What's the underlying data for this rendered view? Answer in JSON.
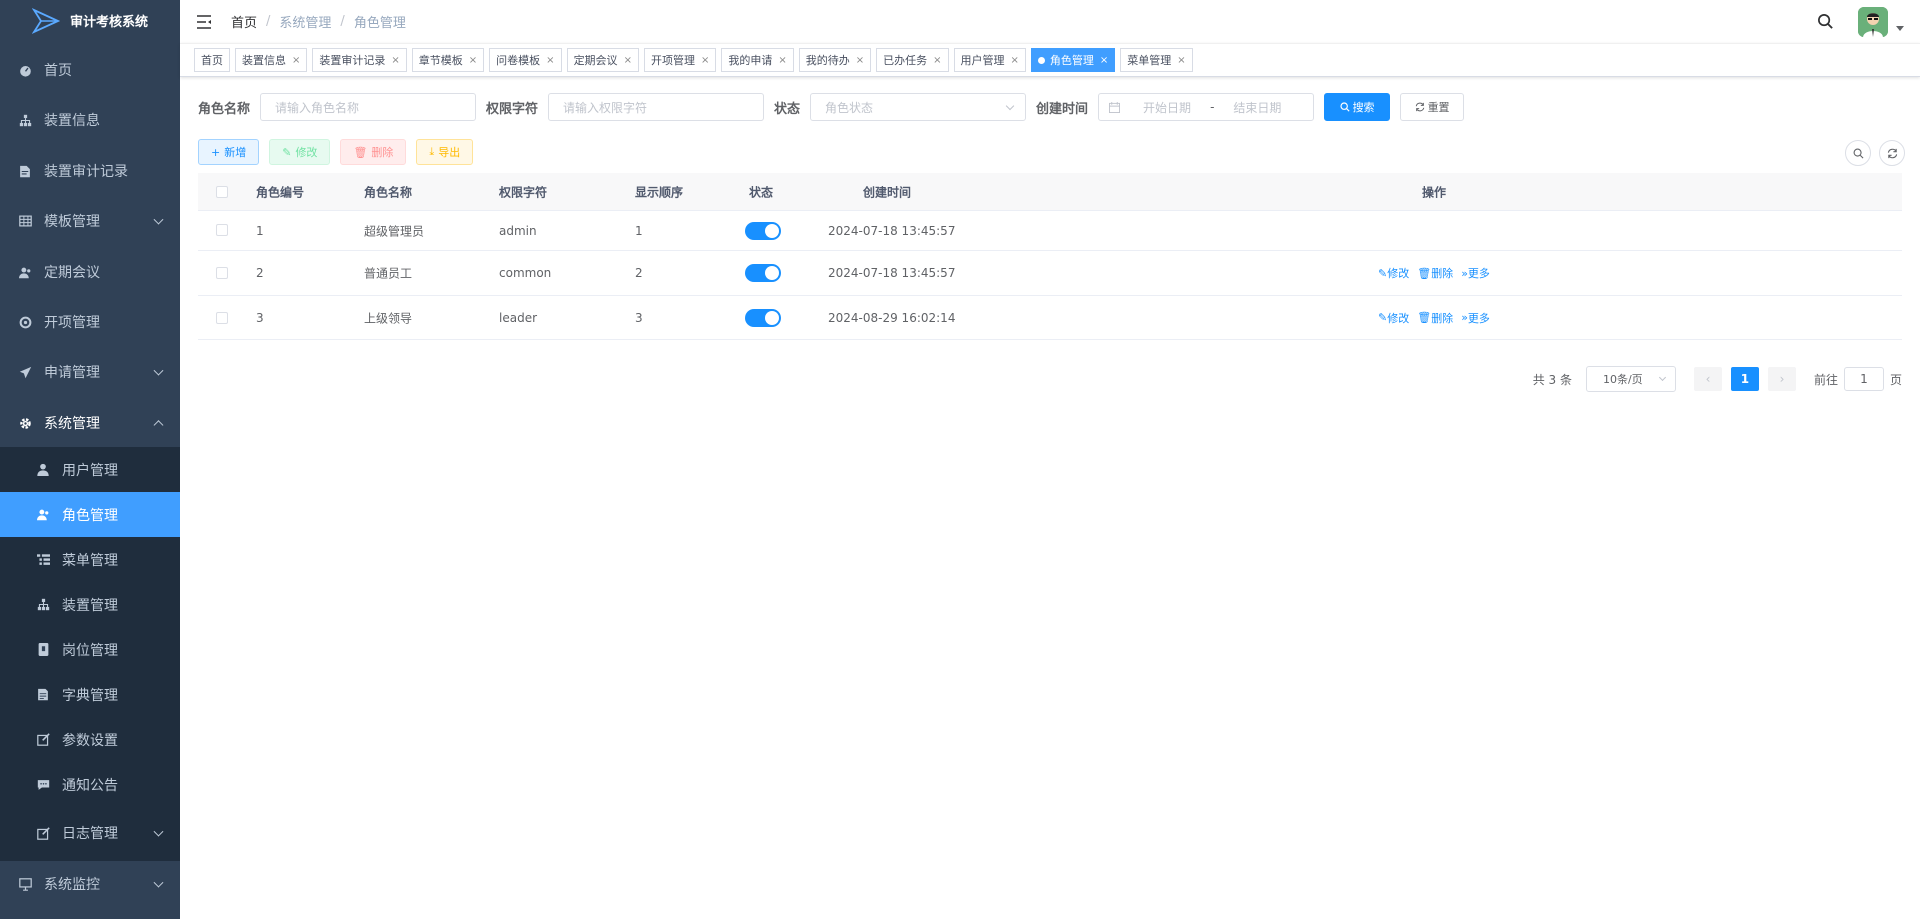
{
  "app": {
    "title": "审计考核系统"
  },
  "sidebar": {
    "items": [
      {
        "label": "首页",
        "icon": "dashboard-icon"
      },
      {
        "label": "装置信息",
        "icon": "tree-icon"
      },
      {
        "label": "装置审计记录",
        "icon": "document-icon"
      },
      {
        "label": "模板管理",
        "icon": "table-icon"
      },
      {
        "label": "定期会议",
        "icon": "users-icon"
      },
      {
        "label": "开项管理",
        "icon": "target-icon"
      },
      {
        "label": "申请管理",
        "icon": "send-icon"
      },
      {
        "label": "系统管理",
        "icon": "gear-icon"
      },
      {
        "label": "日志管理",
        "icon": "log-icon"
      },
      {
        "label": "系统监控",
        "icon": "monitor-icon"
      }
    ],
    "sub_items": [
      {
        "label": "用户管理",
        "icon": "user-icon"
      },
      {
        "label": "角色管理",
        "icon": "peoples-icon"
      },
      {
        "label": "菜单管理",
        "icon": "tree-table-icon"
      },
      {
        "label": "装置管理",
        "icon": "tree-icon"
      },
      {
        "label": "岗位管理",
        "icon": "post-icon"
      },
      {
        "label": "字典管理",
        "icon": "dict-icon"
      },
      {
        "label": "参数设置",
        "icon": "edit-icon"
      },
      {
        "label": "通知公告",
        "icon": "message-icon"
      }
    ]
  },
  "breadcrumb": [
    "首页",
    "系统管理",
    "角色管理"
  ],
  "tags": [
    {
      "label": "首页",
      "closable": false
    },
    {
      "label": "装置信息",
      "closable": true
    },
    {
      "label": "装置审计记录",
      "closable": true
    },
    {
      "label": "章节模板",
      "closable": true
    },
    {
      "label": "问卷模板",
      "closable": true
    },
    {
      "label": "定期会议",
      "closable": true
    },
    {
      "label": "开项管理",
      "closable": true
    },
    {
      "label": "我的申请",
      "closable": true
    },
    {
      "label": "我的待办",
      "closable": true
    },
    {
      "label": "已办任务",
      "closable": true
    },
    {
      "label": "用户管理",
      "closable": true
    },
    {
      "label": "角色管理",
      "closable": true,
      "active": true
    },
    {
      "label": "菜单管理",
      "closable": true
    }
  ],
  "search_form": {
    "role_name_label": "角色名称",
    "role_name_placeholder": "请输入角色名称",
    "perm_label": "权限字符",
    "perm_placeholder": "请输入权限字符",
    "status_label": "状态",
    "status_placeholder": "角色状态",
    "created_label": "创建时间",
    "start_placeholder": "开始日期",
    "range_sep": "-",
    "end_placeholder": "结束日期",
    "search_btn": "搜索",
    "reset_btn": "重置"
  },
  "toolbar": {
    "add": "新增",
    "edit": "修改",
    "delete": "删除",
    "export": "导出"
  },
  "table": {
    "headers": [
      "角色编号",
      "角色名称",
      "权限字符",
      "显示顺序",
      "状态",
      "创建时间",
      "操作"
    ],
    "rows": [
      {
        "id": "1",
        "name": "超级管理员",
        "key": "admin",
        "sort": "1",
        "status": true,
        "created": "2024-07-18 13:45:57",
        "actions": false
      },
      {
        "id": "2",
        "name": "普通员工",
        "key": "common",
        "sort": "2",
        "status": true,
        "created": "2024-07-18 13:45:57",
        "actions": true
      },
      {
        "id": "3",
        "name": "上级领导",
        "key": "leader",
        "sort": "3",
        "status": true,
        "created": "2024-08-29 16:02:14",
        "actions": true
      }
    ],
    "action_labels": {
      "edit": "修改",
      "delete": "删除",
      "more": "更多"
    }
  },
  "pagination": {
    "total_text": "共 3 条",
    "page_size": "10条/页",
    "current": "1",
    "goto_label": "前往",
    "goto_value": "1",
    "page_unit": "页"
  },
  "colors": {
    "primary": "#1890ff",
    "sidebar_bg": "#304156",
    "submenu_bg": "#1f2d3d",
    "active_menu": "#409eff"
  }
}
